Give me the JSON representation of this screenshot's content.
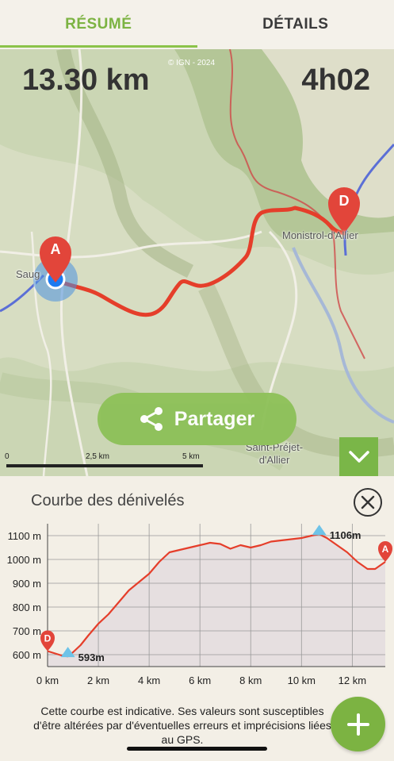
{
  "tabs": [
    {
      "label": "RÉSUMÉ",
      "active": true
    },
    {
      "label": "DÉTAILS",
      "active": false
    }
  ],
  "map": {
    "distance": "13.30 km",
    "duration": "4h02",
    "copyright": "© IGN - 2024",
    "places": {
      "saugues": "Saug",
      "monistrol": "Monistrol-d'Allier",
      "saint_prejet": "Saint-Préjet-\nd'Allier"
    },
    "start_marker": "A",
    "end_marker": "D",
    "scale": {
      "labels": [
        "0",
        "2,5 km",
        "5 km"
      ]
    },
    "share_label": "Partager",
    "collapse_icon": "chevron-down-icon"
  },
  "profile": {
    "title": "Courbe des dénivelés",
    "close_icon": "close-icon",
    "min_label": "593m",
    "max_label": "1106m",
    "start_marker": "D",
    "end_marker": "A",
    "note": "Cette courbe est indicative. Ses valeurs sont susceptibles d'être altérées par d'éventuelles erreurs et imprécisions liées au GPS."
  },
  "chart_data": {
    "type": "area",
    "title": "Courbe des dénivelés",
    "xlabel": "",
    "ylabel": "",
    "x_ticks": [
      "0 km",
      "2 km",
      "4 km",
      "6 km",
      "8 km",
      "10 km",
      "12 km"
    ],
    "y_ticks": [
      "600 m",
      "700 m",
      "800 m",
      "900 m",
      "1000 m",
      "1100 m"
    ],
    "xlim": [
      0,
      13.3
    ],
    "ylim": [
      550,
      1150
    ],
    "x": [
      0,
      0.3,
      0.6,
      0.8,
      1.0,
      1.3,
      1.6,
      2.0,
      2.4,
      2.8,
      3.2,
      3.6,
      4.0,
      4.4,
      4.8,
      5.2,
      5.6,
      6.0,
      6.4,
      6.8,
      7.2,
      7.6,
      8.0,
      8.4,
      8.8,
      9.2,
      9.6,
      10.0,
      10.4,
      10.7,
      11.0,
      11.4,
      11.8,
      12.2,
      12.6,
      12.9,
      13.3
    ],
    "y": [
      615,
      605,
      595,
      593,
      610,
      640,
      680,
      730,
      770,
      820,
      870,
      905,
      940,
      990,
      1030,
      1040,
      1050,
      1060,
      1070,
      1065,
      1045,
      1060,
      1050,
      1060,
      1075,
      1080,
      1085,
      1090,
      1100,
      1106,
      1090,
      1060,
      1030,
      990,
      960,
      960,
      990
    ],
    "points": [
      {
        "label": "593m",
        "x": 0.8,
        "y": 593
      },
      {
        "label": "1106m",
        "x": 10.7,
        "y": 1106
      }
    ],
    "colors": {
      "line": "#e53e2a",
      "fill": "#e6dfe0"
    }
  }
}
